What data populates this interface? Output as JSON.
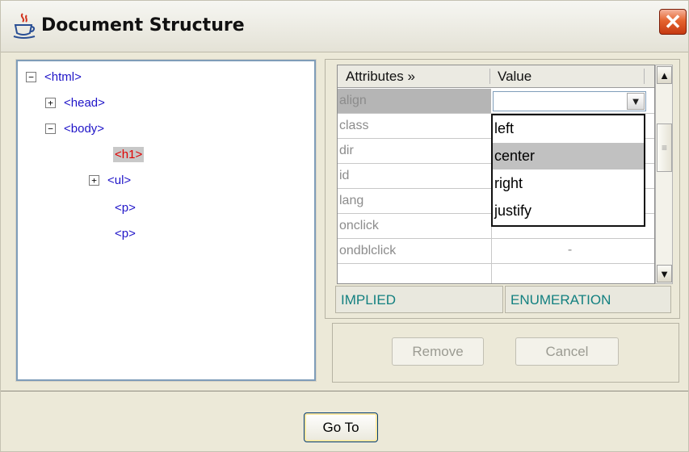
{
  "window": {
    "title": "Document Structure",
    "icon": "java-cup-icon"
  },
  "tree": {
    "nodes": [
      {
        "label": "<html>",
        "expander": "−"
      },
      {
        "label": "<head>",
        "expander": "+"
      },
      {
        "label": "<body>",
        "expander": "−"
      },
      {
        "label": "<h1>",
        "selected": true
      },
      {
        "label": "<ul>",
        "expander": "+"
      },
      {
        "label": "<p>"
      },
      {
        "label": "<p>"
      }
    ]
  },
  "attributes": {
    "headers": {
      "name": "Attributes »",
      "value": "Value"
    },
    "rows": [
      {
        "name": "align",
        "value": ""
      },
      {
        "name": "class",
        "value": ""
      },
      {
        "name": "dir",
        "value": ""
      },
      {
        "name": "id",
        "value": ""
      },
      {
        "name": "lang",
        "value": ""
      },
      {
        "name": "onclick",
        "value": "-"
      },
      {
        "name": "ondblclick",
        "value": "-"
      }
    ],
    "dropdown_options": [
      "left",
      "center",
      "right",
      "justify"
    ],
    "highlighted_option": "center",
    "info": {
      "default": "IMPLIED",
      "type": "ENUMERATION"
    }
  },
  "buttons": {
    "remove": "Remove",
    "cancel": "Cancel",
    "goto": "Go To"
  },
  "colors": {
    "tree_text": "#1f14c8",
    "selected_tag": "#e00000",
    "info_text": "#138080"
  }
}
